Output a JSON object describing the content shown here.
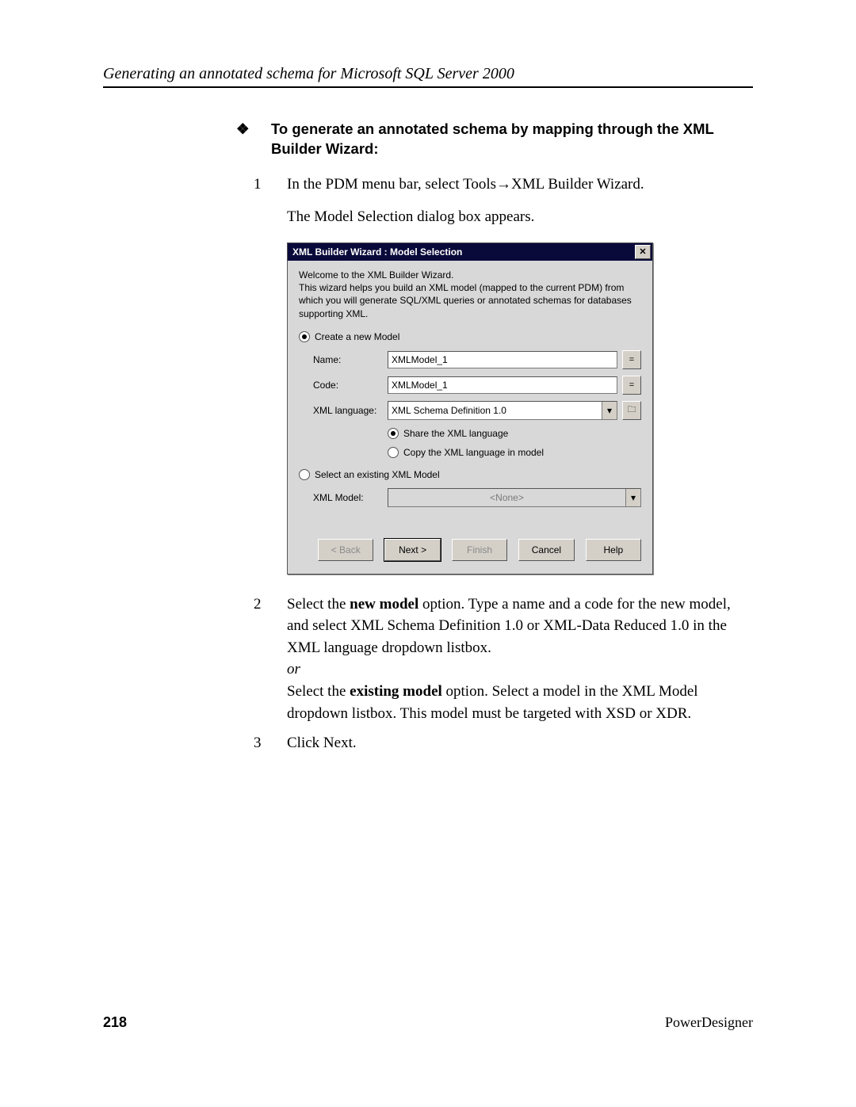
{
  "header": {
    "running": "Generating an annotated schema for Microsoft SQL Server 2000"
  },
  "section": {
    "bullet": "❖",
    "heading": "To generate an annotated schema by mapping through the XML Builder Wizard:"
  },
  "steps": {
    "s1": {
      "num": "1",
      "line1_a": "In the PDM menu bar, select Tools",
      "arrow": "→",
      "line1_b": "XML Builder Wizard.",
      "line2": "The Model Selection dialog box appears."
    },
    "s2": {
      "num": "2",
      "a1": "Select the ",
      "bold1": "new model",
      "a2": " option. Type a name and a code for the new model, and select XML Schema Definition 1.0 or XML-Data Reduced 1.0 in the XML language dropdown listbox.",
      "or": "or",
      "b1": "Select the ",
      "bold2": "existing model",
      "b2": " option. Select a model in the XML Model dropdown listbox. This model must be targeted with XSD or XDR."
    },
    "s3": {
      "num": "3",
      "text": "Click Next."
    }
  },
  "dialog": {
    "title": "XML Builder Wizard : Model Selection",
    "close": "✕",
    "intro1": "Welcome to the XML Builder Wizard.",
    "intro2": "This wizard helps you build an XML model (mapped to the current PDM) from which you will generate SQL/XML queries or annotated schemas for databases supporting XML.",
    "radio_new": "Create a new Model",
    "labels": {
      "name": "Name:",
      "code": "Code:",
      "lang": "XML language:"
    },
    "values": {
      "name": "XMLModel_1",
      "code": "XMLModel_1",
      "lang": "XML Schema Definition 1.0"
    },
    "sub": {
      "share": "Share the XML language",
      "copy": "Copy the XML language in model"
    },
    "radio_existing": "Select an existing XML Model",
    "labels2": {
      "model": "XML Model:"
    },
    "values2": {
      "model": "<None>"
    },
    "icons": {
      "eq": "=",
      "arrow": "▾",
      "folder": "🗀"
    },
    "buttons": {
      "back": "< Back",
      "next": "Next >",
      "finish": "Finish",
      "cancel": "Cancel",
      "help": "Help"
    }
  },
  "footer": {
    "page": "218",
    "product": "PowerDesigner"
  }
}
